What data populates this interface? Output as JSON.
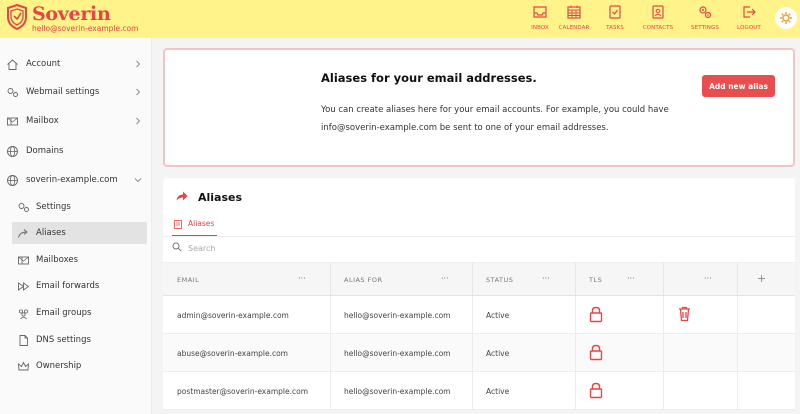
{
  "brand": {
    "name": "Soverin",
    "email": "hello@soverin-example.com"
  },
  "nav": [
    {
      "label": "INBOX",
      "icon": "inbox-icon"
    },
    {
      "label": "CALENDAR",
      "icon": "calendar-icon"
    },
    {
      "label": "TASKS",
      "icon": "tasks-icon"
    },
    {
      "label": "CONTACTS",
      "icon": "contacts-icon"
    },
    {
      "label": "SETTINGS",
      "icon": "settings-icon"
    },
    {
      "label": "LOGOUT",
      "icon": "logout-icon"
    }
  ],
  "sidebar": {
    "items": [
      {
        "label": "Account",
        "icon": "home-icon"
      },
      {
        "label": "Webmail settings",
        "icon": "gears-icon"
      },
      {
        "label": "Mailbox",
        "icon": "mailbox-icon"
      },
      {
        "label": "Domains",
        "icon": "globe-icon"
      },
      {
        "label": "soverin-example.com",
        "icon": "globe-icon"
      }
    ],
    "subitems": [
      {
        "label": "Settings",
        "icon": "gears-icon"
      },
      {
        "label": "Aliases",
        "icon": "forward-arrow-icon"
      },
      {
        "label": "Mailboxes",
        "icon": "mailbox-icon"
      },
      {
        "label": "Email forwards",
        "icon": "fast-forward-icon"
      },
      {
        "label": "Email groups",
        "icon": "group-icon"
      },
      {
        "label": "DNS settings",
        "icon": "document-icon"
      },
      {
        "label": "Ownership",
        "icon": "crown-icon"
      }
    ]
  },
  "intro": {
    "title": "Aliases for your email addresses.",
    "text": "You can create aliases here for your email accounts. For example, you could have info@soverin-example.com be sent to one of your email addresses.",
    "button": "Add new alias"
  },
  "panel": {
    "title": "Aliases",
    "tab": "Aliases",
    "search_placeholder": "Search"
  },
  "table": {
    "columns": [
      "EMAIL",
      "ALIAS FOR",
      "STATUS",
      "TLS"
    ],
    "dots": "···",
    "plus": "+",
    "rows": [
      {
        "email": "admin@soverin-example.com",
        "alias_for": "hello@soverin-example.com",
        "status": "Active"
      },
      {
        "email": "abuse@soverin-example.com",
        "alias_for": "hello@soverin-example.com",
        "status": "Active"
      },
      {
        "email": "postmaster@soverin-example.com",
        "alias_for": "hello@soverin-example.com",
        "status": "Active"
      }
    ]
  },
  "colors": {
    "accent": "#e64545",
    "topbar": "#fff38a",
    "button": "#e94e4e"
  }
}
